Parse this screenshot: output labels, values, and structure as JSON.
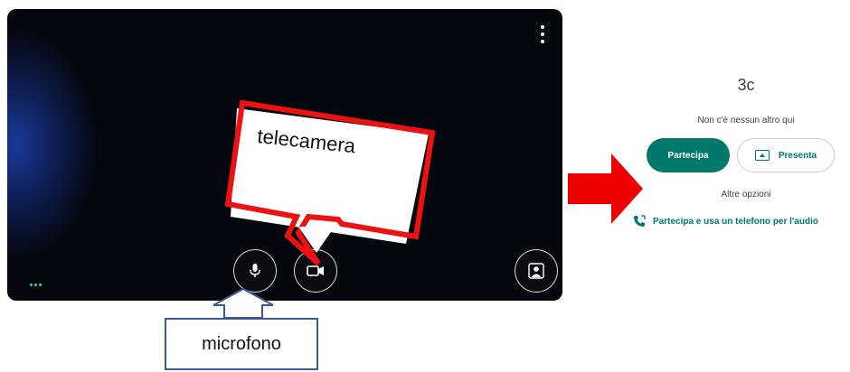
{
  "annotations": {
    "camera_label": "telecamera",
    "mic_label": "microfono"
  },
  "meeting": {
    "title": "3c",
    "status": "Non c'è nessun altro qui",
    "join_label": "Partecipa",
    "present_label": "Presenta",
    "other_options": "Altre opzioni",
    "phone_audio_link": "Partecipa e usa un telefono per l'audio"
  },
  "colors": {
    "accent": "#00796b",
    "callout_red": "#ee1111",
    "arrow_red": "#ee0000",
    "callout_blue": "#3b5a8f"
  },
  "icons": [
    "more-vert-icon",
    "microphone-icon",
    "camera-icon",
    "effects-icon",
    "present-screen-icon",
    "phone-icon"
  ]
}
